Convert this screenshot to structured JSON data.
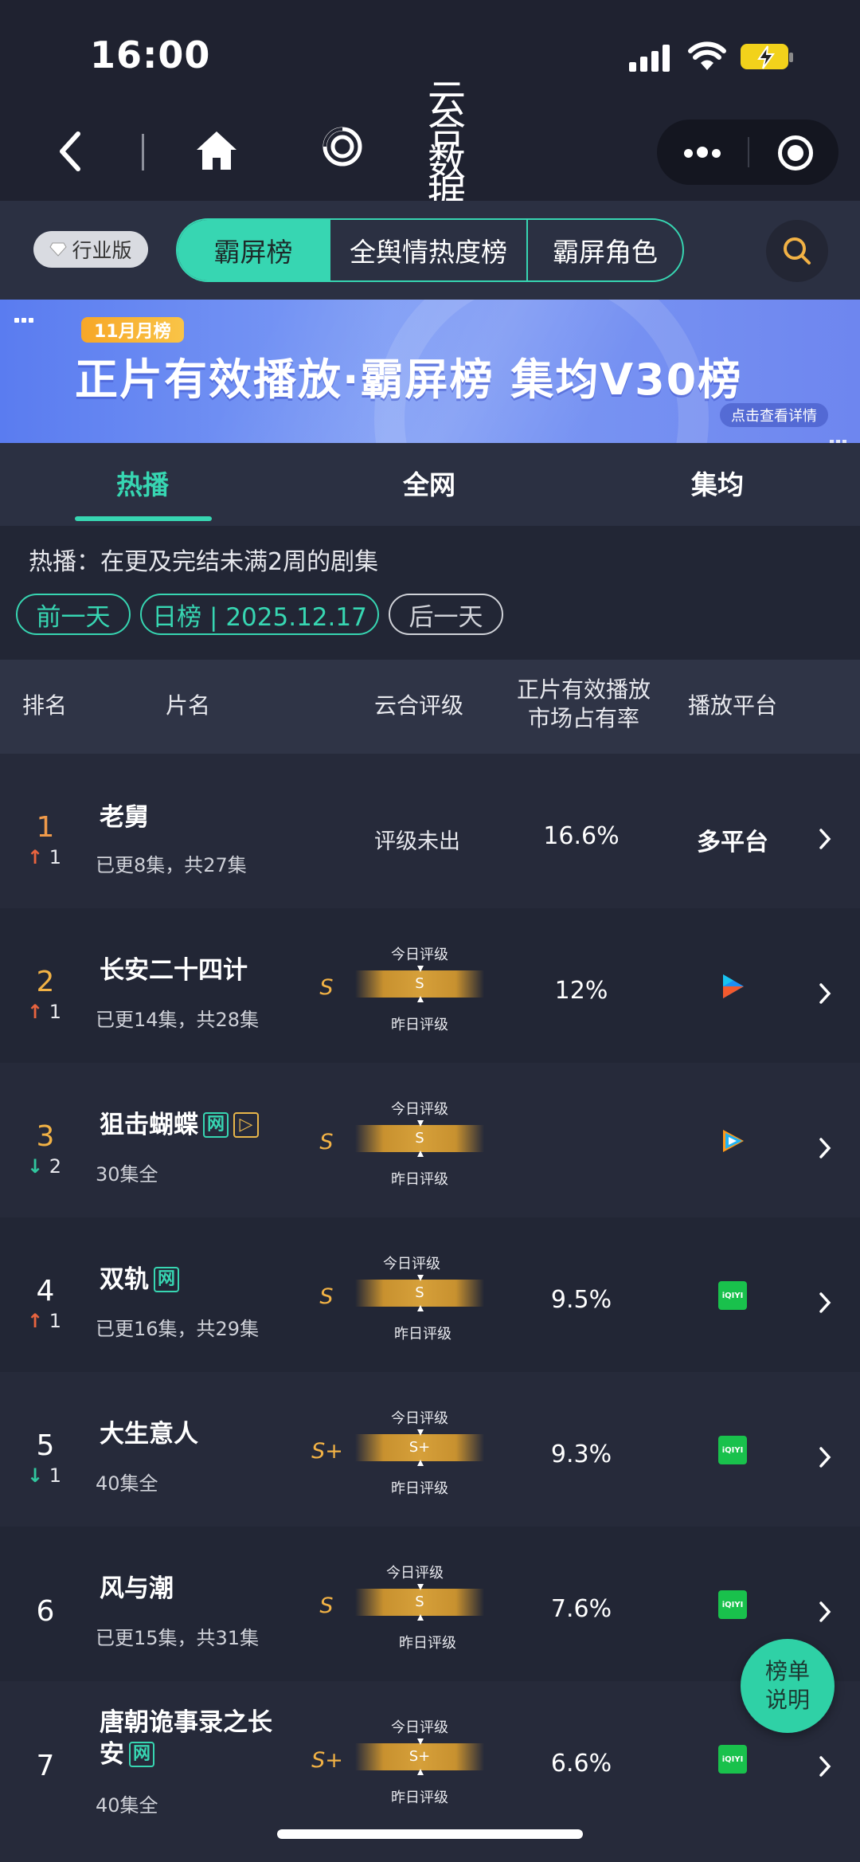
{
  "status_bar": {
    "time": "16:00"
  },
  "nav": {
    "brand": "云合数据"
  },
  "toolbar": {
    "edition_badge": "行业版",
    "segments": [
      "霸屏榜",
      "全舆情热度榜",
      "霸屏角色"
    ],
    "active_segment": 0
  },
  "banner": {
    "tag": "11月月榜",
    "title": "正片有效播放·霸屏榜 集均V30榜",
    "detail_link": "点击查看详情"
  },
  "sub_tabs": [
    "热播",
    "全网",
    "集均"
  ],
  "description": "热播：在更及完结未满2周的剧集",
  "date_nav": {
    "prev": "前一天",
    "current": "日榜 | 2025.12.17",
    "next": "后一天"
  },
  "table": {
    "headers": {
      "rank": "排名",
      "title": "片名",
      "grade": "云合评级",
      "share_line1": "正片有效播放",
      "share_line2": "市场占有率",
      "platform": "播放平台"
    },
    "grade_today_label": "今日评级",
    "grade_yesterday_label": "昨日评级",
    "rows": [
      {
        "rank": "1",
        "trend_dir": "up",
        "trend_arrow": "↑",
        "trend_val": "1",
        "title": "老舅",
        "episodes": "已更8集，共27集",
        "grade_text": "评级未出",
        "grade": "",
        "share": "16.6%",
        "platform": "多平台",
        "platform_icon": ""
      },
      {
        "rank": "2",
        "trend_dir": "up",
        "trend_arrow": "↑",
        "trend_val": "1",
        "title": "长安二十四计",
        "episodes": "已更14集，共28集",
        "grade_text": "",
        "grade": "S",
        "grade_bar": "S",
        "share": "12%",
        "platform": "",
        "platform_icon": "youku-icon"
      },
      {
        "rank": "3",
        "trend_dir": "down",
        "trend_arrow": "↓",
        "trend_val": "2",
        "title": "狙击蝴蝶",
        "tags": [
          "网",
          "▷"
        ],
        "episodes": "30集全",
        "grade_text": "",
        "grade": "S",
        "grade_bar": "S",
        "share": "",
        "platform": "",
        "platform_icon": "tencent-video-icon"
      },
      {
        "rank": "4",
        "trend_dir": "up",
        "trend_arrow": "↑",
        "trend_val": "1",
        "title": "双轨",
        "tags": [
          "网"
        ],
        "episodes": "已更16集，共29集",
        "grade_text": "",
        "grade": "S",
        "grade_bar": "S",
        "share": "9.5%",
        "platform": "",
        "platform_icon": "iqiyi-icon"
      },
      {
        "rank": "5",
        "trend_dir": "down",
        "trend_arrow": "↓",
        "trend_val": "1",
        "title": "大生意人",
        "episodes": "40集全",
        "grade_text": "",
        "grade": "S+",
        "grade_bar": "S+",
        "share": "9.3%",
        "platform": "",
        "platform_icon": "iqiyi-icon"
      },
      {
        "rank": "6",
        "trend_dir": "",
        "trend_arrow": "",
        "trend_val": "",
        "title": "风与潮",
        "episodes": "已更15集，共31集",
        "grade_text": "",
        "grade": "S",
        "grade_bar": "S",
        "share": "7.6%",
        "platform": "",
        "platform_icon": "iqiyi-icon"
      },
      {
        "rank": "7",
        "trend_dir": "",
        "trend_arrow": "",
        "trend_val": "",
        "title_line1": "唐朝诡事录之长",
        "title_line2": "安",
        "tags": [
          "网"
        ],
        "episodes": "40集全",
        "grade_text": "",
        "grade": "S+",
        "grade_bar": "S+",
        "share": "6.6%",
        "platform": "",
        "platform_icon": "iqiyi-icon"
      }
    ]
  },
  "iqiyi_label": "iQIYI",
  "fab": {
    "line1": "榜单",
    "line2": "说明"
  },
  "colors": {
    "accent": "#37d6b2",
    "grade_gold": "#f2b245",
    "up": "#e9643f",
    "down": "#31c79f"
  }
}
